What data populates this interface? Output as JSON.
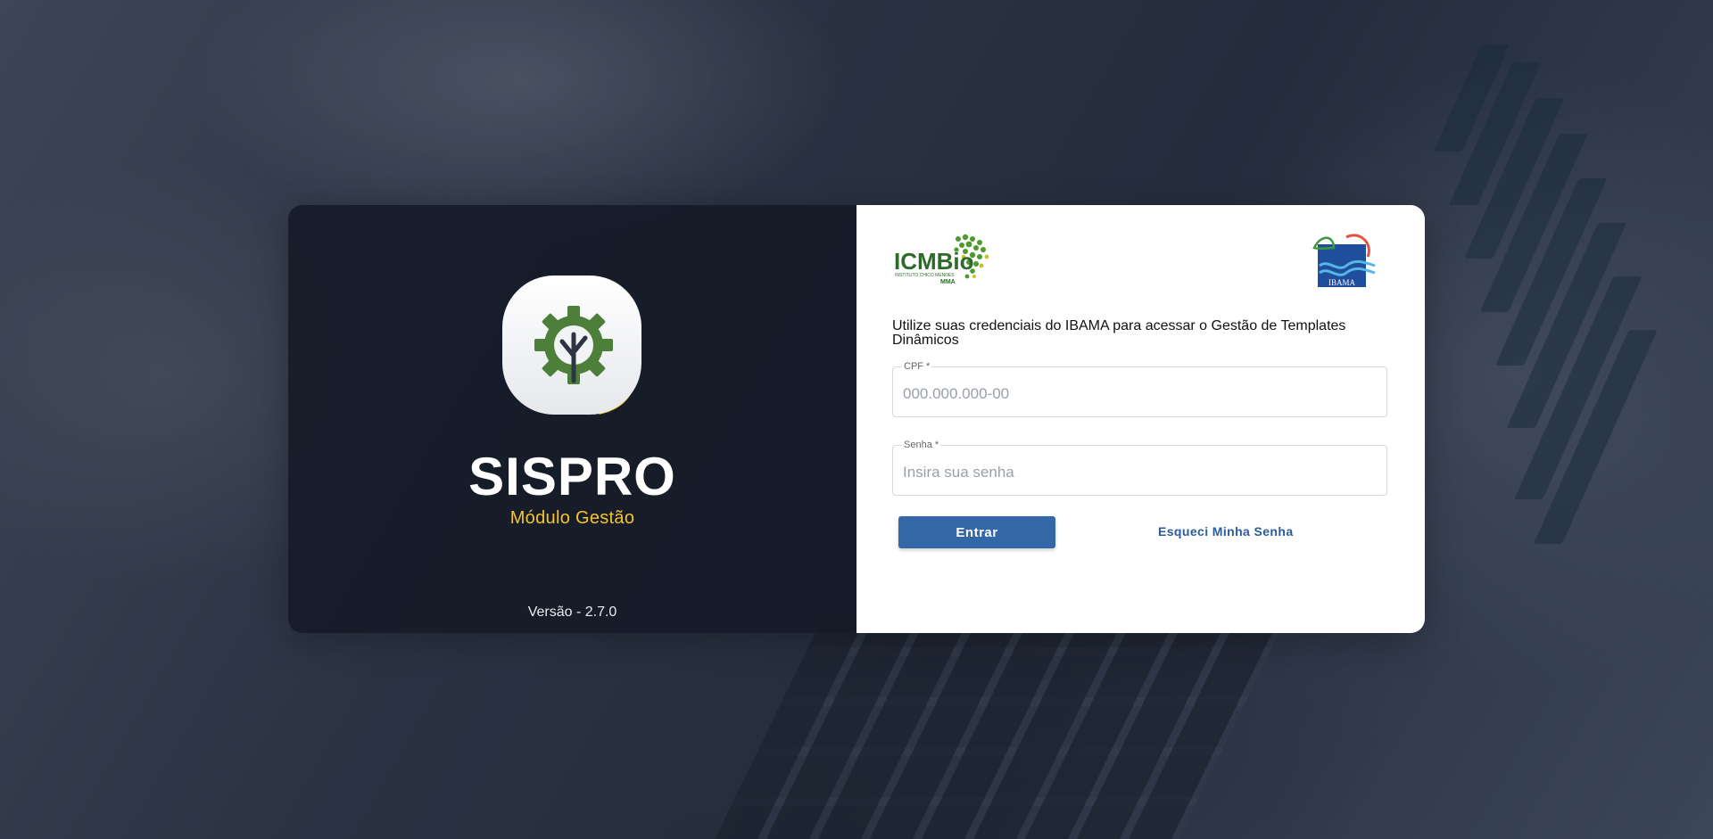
{
  "app": {
    "name": "SISPRO",
    "module": "Módulo Gestão",
    "version": "Versão - 2.7.0"
  },
  "logos": {
    "left": {
      "name": "icmbio-logo",
      "text": "ICMBio",
      "subtext": "INSTITUTO CHICO MENDES",
      "ministry": "MMA"
    },
    "right": {
      "name": "ibama-logo",
      "text": "IBAMA"
    }
  },
  "login": {
    "instructions": "Utilize suas credenciais do IBAMA para acessar o Gestão de Templates Dinâmicos",
    "cpf": {
      "label": "CPF *",
      "placeholder": "000.000.000-00",
      "value": ""
    },
    "password": {
      "label": "Senha *",
      "placeholder": "Insira sua senha",
      "value": ""
    },
    "submit_label": "Entrar",
    "forgot_label": "Esqueci Minha Senha"
  },
  "colors": {
    "left_panel": "#151b28",
    "accent_yellow": "#f4c430",
    "button_blue": "#3467a8",
    "link_blue": "#2a5d9a",
    "icon_green": "#4e7f3a"
  },
  "icons": {
    "app_icon": "gear-tree-icon"
  }
}
